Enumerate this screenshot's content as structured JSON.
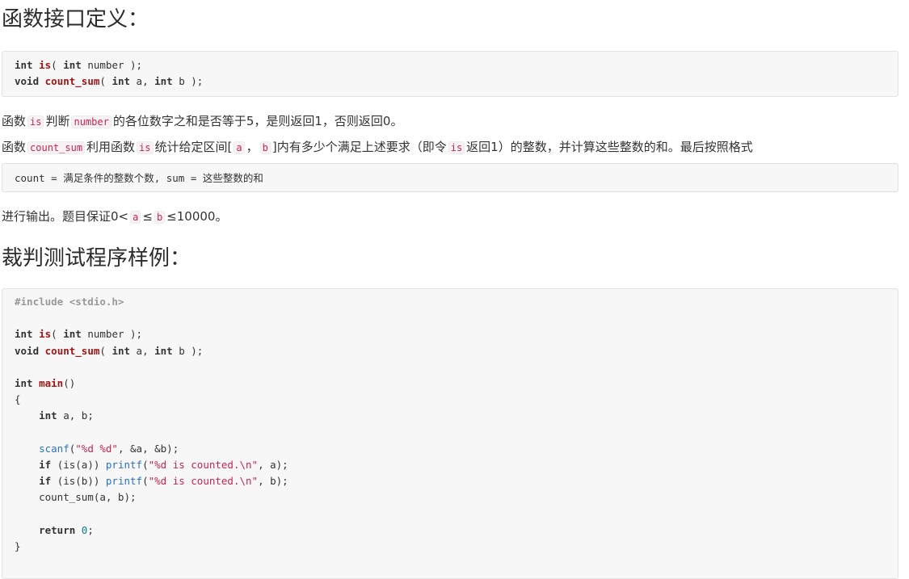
{
  "heading_interface": "函数接口定义：",
  "interface_code": {
    "line1": {
      "kw1": "int",
      "fn1": "is",
      "t1": "( ",
      "kw2": "int",
      "t2": " number );"
    },
    "line2": {
      "kw1": "void",
      "fn1": "count_sum",
      "t1": "( ",
      "kw2": "int",
      "t2": " a, ",
      "kw3": "int",
      "t3": " b );"
    }
  },
  "desc1": {
    "p1": "函数",
    "c1": "is",
    "p2": "判断",
    "c2": "number",
    "p3": "的各位数字之和是否等于5，是则返回1，否则返回0。"
  },
  "desc2": {
    "p1": "函数",
    "c1": "count_sum",
    "p2": "利用函数",
    "c2": "is",
    "p3": "统计给定区间[",
    "c3": "a",
    "p4": "，",
    "c4": "b",
    "p5": "]内有多少个满足上述要求（即令",
    "c5": "is",
    "p6": "返回1）的整数，并计算这些整数的和。最后按照格式"
  },
  "format_code": "count = 满足条件的整数个数, sum = 这些整数的和",
  "desc3": {
    "p1": "进行输出。题目保证0<",
    "c1": "a",
    "p2": "≤",
    "c2": "b",
    "p3": "≤10000。"
  },
  "heading_test": "裁判测试程序样例：",
  "test_code": {
    "include": "#include <stdio.h>",
    "l3": {
      "kw1": "int",
      "fn1": "is",
      "t1": "( ",
      "kw2": "int",
      "t2": " number );"
    },
    "l4": {
      "kw1": "void",
      "fn1": "count_sum",
      "t1": "( ",
      "kw2": "int",
      "t2": " a, ",
      "kw3": "int",
      "t3": " b );"
    },
    "l6": {
      "kw1": "int",
      "fn1": "main",
      "t1": "()"
    },
    "l7": "{",
    "l8": {
      "indent": "    ",
      "kw1": "int",
      "t1": " a, b;"
    },
    "l10": {
      "indent": "    ",
      "call": "scanf",
      "t1": "(",
      "str": "\"%d %d\"",
      "t2": ", &a, &b);"
    },
    "l11": {
      "indent": "    ",
      "kw1": "if",
      "t1": " (is(a)) ",
      "call": "printf",
      "t2": "(",
      "str": "\"%d is counted.\\n\"",
      "t3": ", a);"
    },
    "l12": {
      "indent": "    ",
      "kw1": "if",
      "t1": " (is(b)) ",
      "call": "printf",
      "t2": "(",
      "str": "\"%d is counted.\\n\"",
      "t3": ", b);"
    },
    "l13": "    count_sum(a, b);",
    "l15": {
      "indent": "    ",
      "kw1": "return",
      "t1": " ",
      "num": "0",
      "t2": ";"
    },
    "l16": "}"
  }
}
